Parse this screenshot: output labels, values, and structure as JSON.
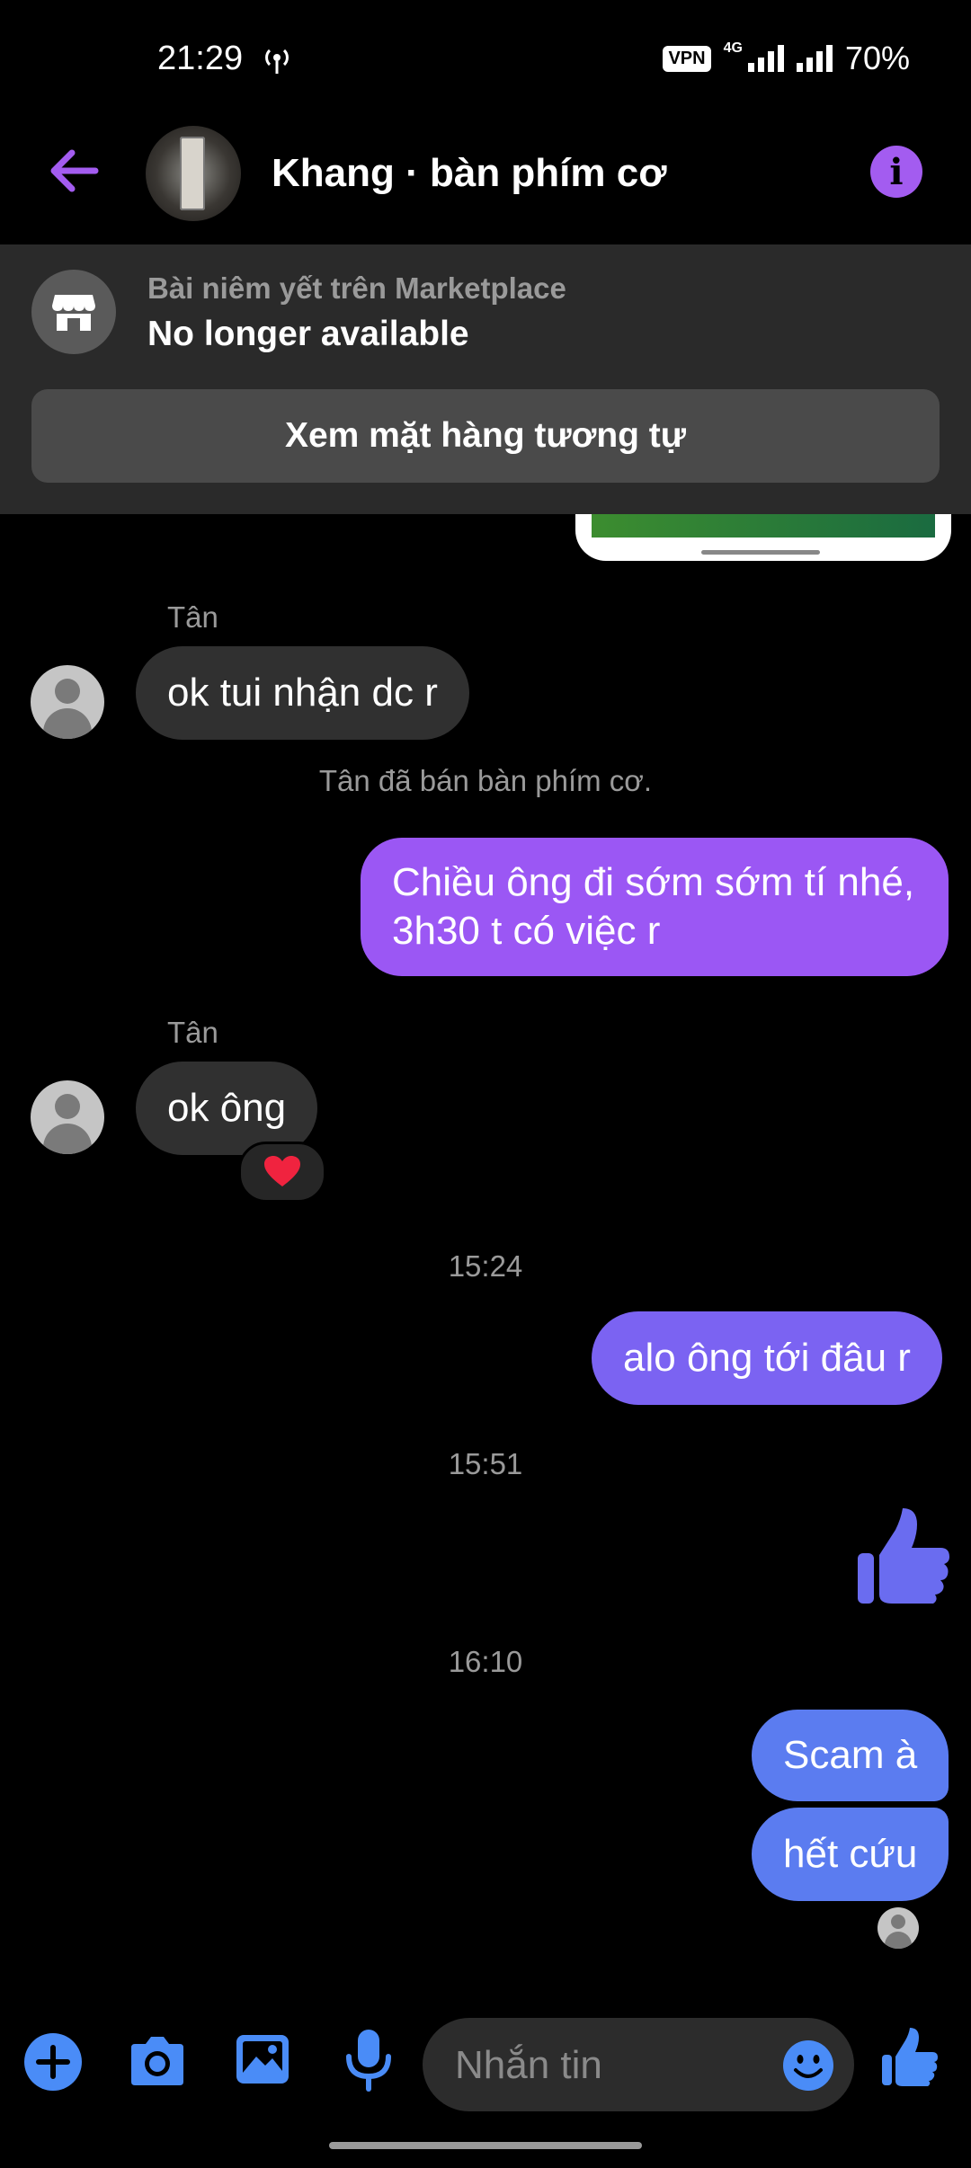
{
  "status_bar": {
    "time": "21:29",
    "vpn": "VPN",
    "network": "4G",
    "battery": "70%"
  },
  "header": {
    "title": "Khang · bàn phím cơ",
    "icons": {
      "back": "arrow-left-icon",
      "info": "info-icon"
    },
    "accent_color": "#a35cf0"
  },
  "marketplace": {
    "subtitle": "Bài niêm yết trên Marketplace",
    "status": "No longer available",
    "button_label": "Xem mặt hàng tương tự"
  },
  "messages": [
    {
      "sender": "Tân",
      "text": "ok tui nhận dc r"
    },
    {
      "system": "Tân đã bán bàn phím cơ."
    },
    {
      "from_me": true,
      "lines": [
        "Chiều ông đi sớm sớm tí nhé,",
        "3h30 t có việc r"
      ]
    },
    {
      "sender": "Tân",
      "text": "ok ông",
      "reaction": "heart"
    },
    {
      "timestamp": "15:24"
    },
    {
      "from_me": true,
      "text": "alo ông tới đâu r"
    },
    {
      "timestamp": "15:51"
    },
    {
      "from_me": true,
      "sticker": "thumbs-up"
    },
    {
      "timestamp": "16:10"
    },
    {
      "from_me": true,
      "text": "Scam à"
    },
    {
      "from_me": true,
      "text": "hết cứu"
    }
  ],
  "composer": {
    "placeholder": "Nhắn tin",
    "icons": [
      "plus-icon",
      "camera-icon",
      "image-icon",
      "microphone-icon",
      "emoji-icon",
      "thumbs-up-icon"
    ]
  },
  "colors": {
    "bubble_purple": "#9b57f4",
    "bubble_indigo": "#7b63f2",
    "bubble_blue": "#5b7cf0",
    "bubble_incoming": "#303030",
    "composer_icon": "#4a8cf7"
  }
}
